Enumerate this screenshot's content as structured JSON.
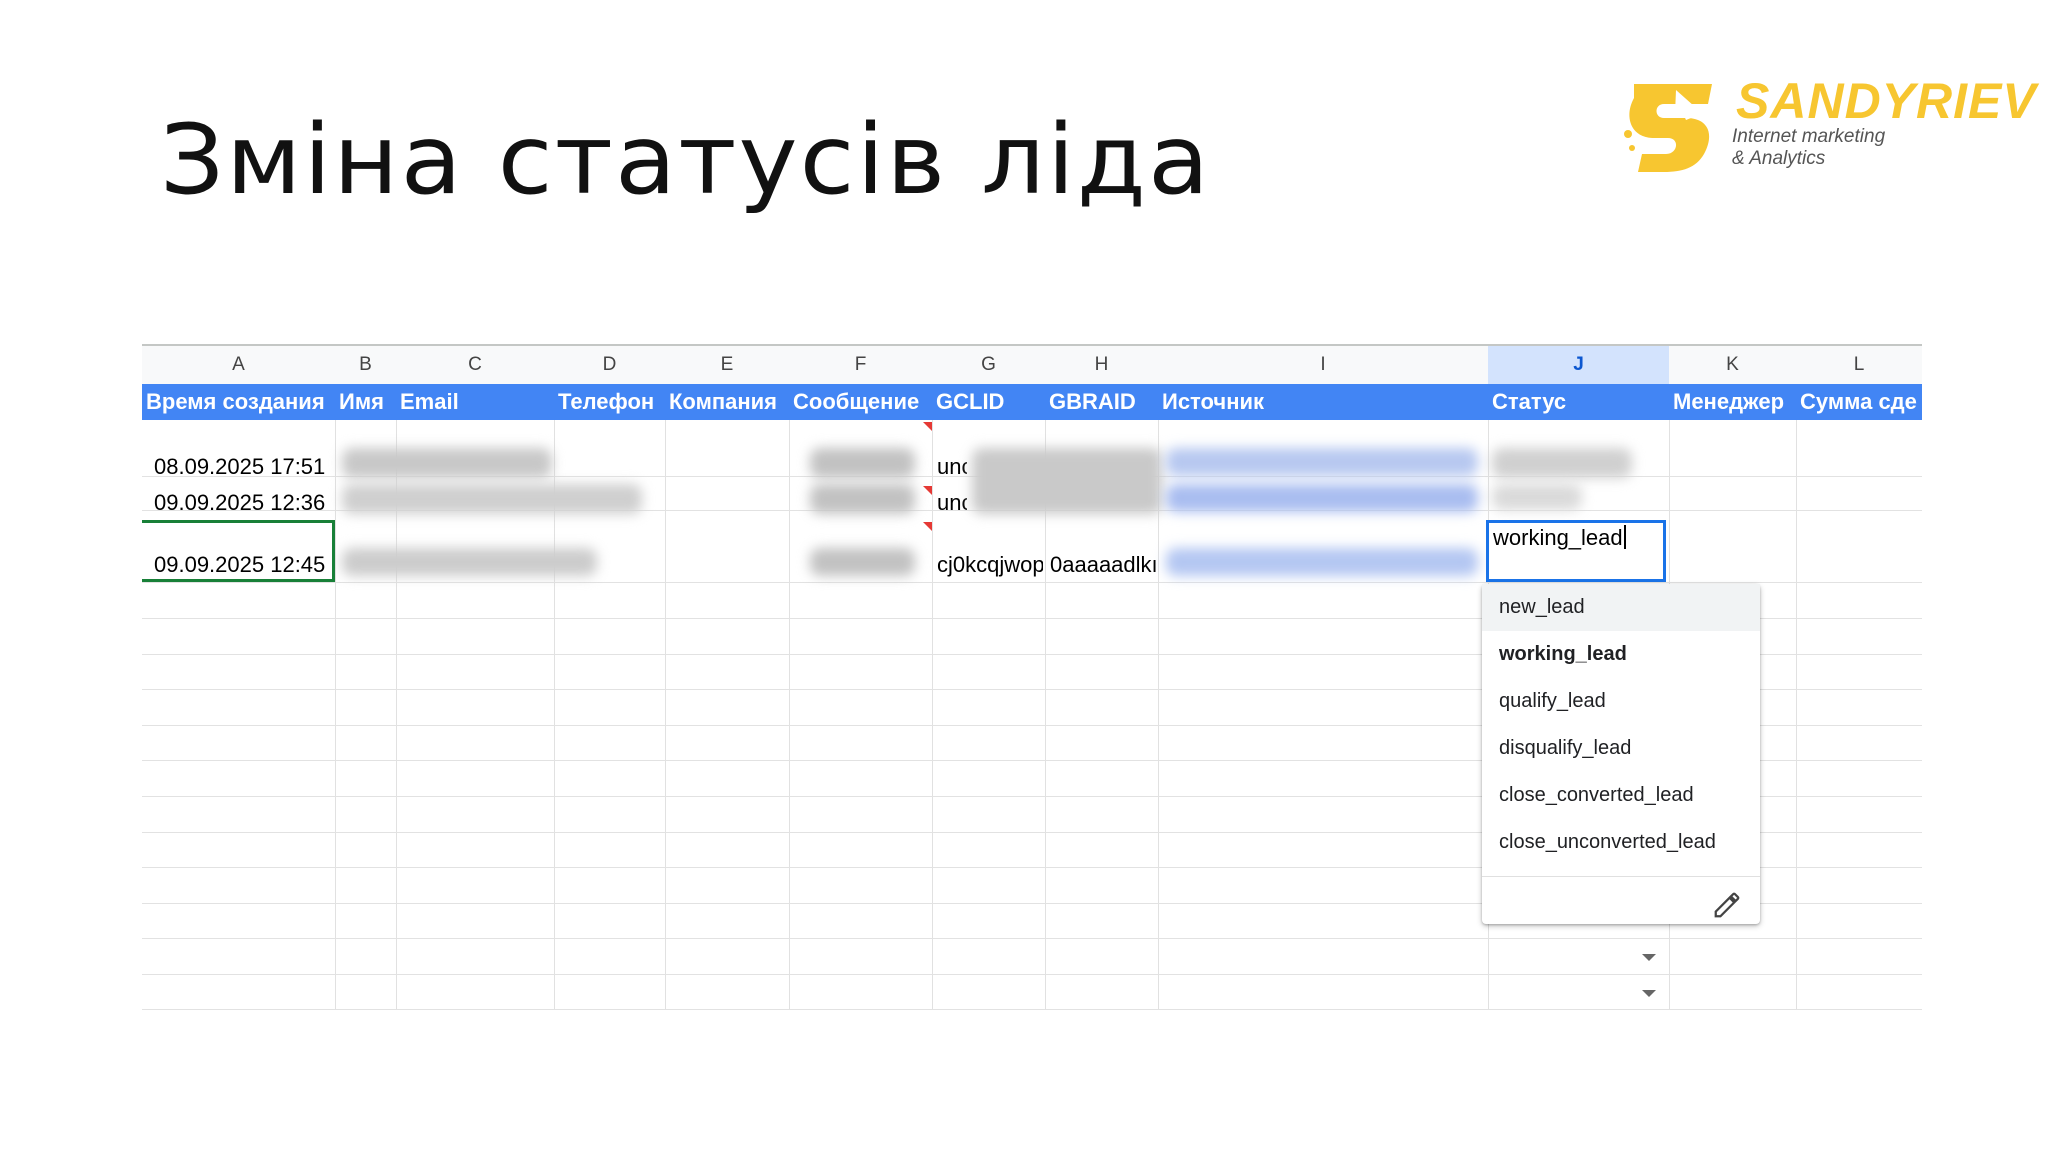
{
  "slide": {
    "title": "Зміна статусів ліда"
  },
  "logo": {
    "name": "SANDYRIEV",
    "tagline_1": "Internet marketing",
    "tagline_2": "& Analytics",
    "color": "#f7c630",
    "icon": "s-arrow-logo-icon"
  },
  "sheet": {
    "column_letters": [
      "A",
      "B",
      "C",
      "D",
      "E",
      "F",
      "G",
      "H",
      "I",
      "J",
      "K",
      "L"
    ],
    "selected_column": "J",
    "header_color": "#4285f4",
    "headers": [
      "Время создания",
      "Имя",
      "Email",
      "Телефон",
      "Компания",
      "Сообщение",
      "GCLID",
      "GBRAID",
      "Источник",
      "Статус",
      "Менеджер",
      "Сумма сде"
    ],
    "rows": [
      {
        "created": "08.09.2025 17:51",
        "gclid": "unc",
        "gbraid": ""
      },
      {
        "created": "09.09.2025 12:36",
        "gclid": "unc",
        "gbraid": ""
      },
      {
        "created": "09.09.2025 12:45",
        "gclid": "cj0kcqjwop",
        "gbraid": "0aaaaadlkı"
      }
    ],
    "active_cell": {
      "value": "working_lead"
    },
    "status_options": [
      "new_lead",
      "working_lead",
      "qualify_lead",
      "disqualify_lead",
      "close_converted_lead",
      "close_unconverted_lead"
    ],
    "selected_option": "working_lead",
    "edit_icon": "pencil-icon"
  }
}
